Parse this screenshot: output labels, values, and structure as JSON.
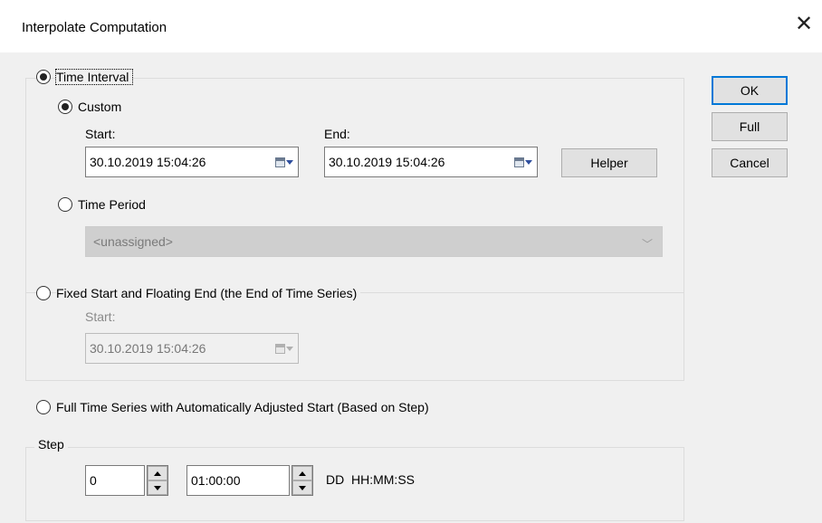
{
  "window": {
    "title": "Interpolate Computation",
    "close_icon": "close-icon"
  },
  "time_interval": {
    "label": "Time Interval",
    "selected": true,
    "custom": {
      "label": "Custom",
      "selected": true,
      "start_label": "Start:",
      "start_value": "30.10.2019 15:04:26",
      "end_label": "End:",
      "end_value": "30.10.2019 15:04:26"
    },
    "time_period": {
      "label": "Time Period",
      "selected": false,
      "combo_value": "<unassigned>"
    },
    "helper_label": "Helper"
  },
  "fixed_start": {
    "label": "Fixed Start and Floating End (the End of Time Series)",
    "selected": false,
    "start_label": "Start:",
    "start_value": "30.10.2019 15:04:26"
  },
  "full_series": {
    "label": "Full Time Series with Automatically Adjusted Start (Based on Step)",
    "selected": false
  },
  "step": {
    "label": "Step",
    "days_value": "0",
    "time_value": "01:00:00",
    "format_label": "DD  HH:MM:SS"
  },
  "buttons": {
    "ok": "OK",
    "full": "Full",
    "cancel": "Cancel"
  }
}
